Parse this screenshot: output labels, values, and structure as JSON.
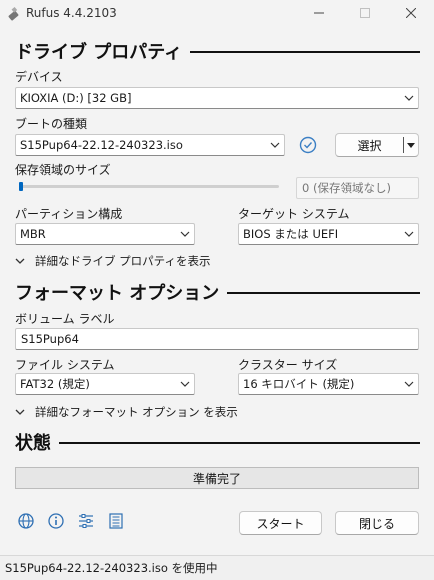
{
  "window": {
    "title": "Rufus 4.4.2103"
  },
  "drive_properties": {
    "section_title": "ドライブ プロパティ",
    "device_label": "デバイス",
    "device_value": "KIOXIA (D:) [32 GB]",
    "boot_type_label": "ブートの種類",
    "boot_type_value": "S15Pup64-22.12-240323.iso",
    "select_button": "選択",
    "persistent_label": "保存領域のサイズ",
    "persistent_value": "0 (保存領域なし)",
    "persistent_fraction": 0,
    "partition_label": "パーティション構成",
    "partition_value": "MBR",
    "target_label": "ターゲット システム",
    "target_value": "BIOS または UEFI",
    "advanced_toggle": "詳細なドライブ プロパティを表示"
  },
  "format_options": {
    "section_title": "フォーマット オプション",
    "volume_label_label": "ボリューム ラベル",
    "volume_label_value": "S15Pup64",
    "fs_label": "ファイル システム",
    "fs_value": "FAT32 (規定)",
    "cluster_label": "クラスター サイズ",
    "cluster_value": "16 キロバイト (規定)",
    "advanced_toggle": "詳細なフォーマット オプション を表示"
  },
  "status": {
    "section_title": "状態",
    "progress_text": "準備完了"
  },
  "footer": {
    "start_button": "スタート",
    "close_button": "閉じる",
    "statusbar_text": "S15Pup64-22.12-240323.iso を使用中"
  },
  "colors": {
    "accent": "#0067c0",
    "checkmark": "#3b7fc4"
  }
}
